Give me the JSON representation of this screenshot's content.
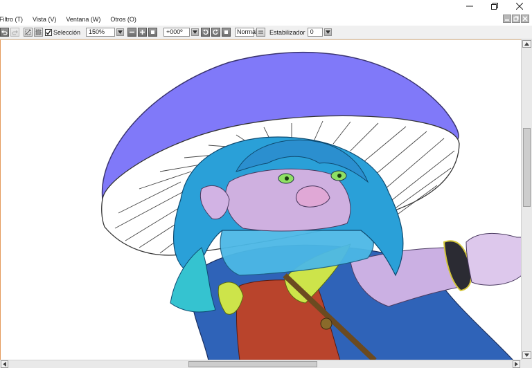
{
  "menu": {
    "items": [
      "Filtro (T)",
      "Vista (V)",
      "Ventana (W)",
      "Otros (O)"
    ]
  },
  "toolbar": {
    "selection_label": "Selección",
    "selection_checked": true,
    "zoom_value": "150%",
    "rotation_value": "+000º",
    "blend_mode": "Normal",
    "stabilizer_label": "Estabilizador",
    "stabilizer_value": "0"
  },
  "scroll": {
    "vertical_position": 0.35,
    "horizontal_position": 0.37
  },
  "icons": {
    "undo": "undo-icon",
    "redo": "redo-icon",
    "deselect": "deselect-icon",
    "invert_selection": "invert-selection-icon",
    "zoom_out": "zoom-out-icon",
    "zoom_in": "zoom-in-icon",
    "zoom_reset": "zoom-reset-icon",
    "rotate_left": "rotate-left-icon",
    "rotate_right": "rotate-right-icon",
    "rotate_reset": "rotate-reset-icon",
    "flip": "flip-horizontal-icon"
  },
  "colors": {
    "mushroom_cap": "#8079f9",
    "hair": "#2aa0d8",
    "skin": "#d5b3e6",
    "cloak": "#2f63b8",
    "tunic": "#b9442c",
    "trim": "#cde44a",
    "canvas_border": "#e49a5a"
  }
}
